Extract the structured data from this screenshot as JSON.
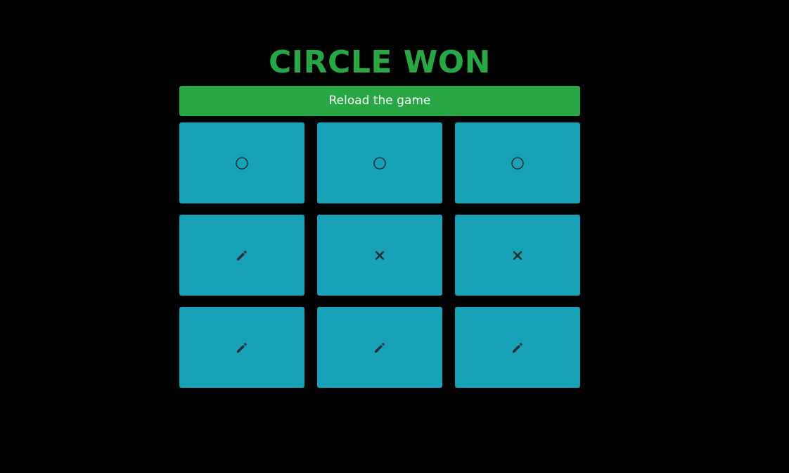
{
  "game": {
    "status_text": "CIRCLE WON",
    "reload_label": "Reload the game"
  },
  "board": {
    "cells": [
      {
        "row": 1,
        "col": 1,
        "state": "circle",
        "icon": "circle-icon"
      },
      {
        "row": 1,
        "col": 2,
        "state": "circle",
        "icon": "circle-icon"
      },
      {
        "row": 1,
        "col": 3,
        "state": "circle",
        "icon": "circle-icon"
      },
      {
        "row": 2,
        "col": 1,
        "state": "empty",
        "icon": "pencil-icon"
      },
      {
        "row": 2,
        "col": 2,
        "state": "cross",
        "icon": "cross-icon"
      },
      {
        "row": 2,
        "col": 3,
        "state": "cross",
        "icon": "cross-icon"
      },
      {
        "row": 3,
        "col": 1,
        "state": "empty",
        "icon": "pencil-icon"
      },
      {
        "row": 3,
        "col": 2,
        "state": "empty",
        "icon": "pencil-icon"
      },
      {
        "row": 3,
        "col": 3,
        "state": "empty",
        "icon": "pencil-icon"
      }
    ]
  },
  "colors": {
    "background": "#000000",
    "accent_green": "#28a745",
    "cell_teal": "#17a2b8",
    "icon_dark": "#1f2d33",
    "button_text": "#ffffff"
  }
}
